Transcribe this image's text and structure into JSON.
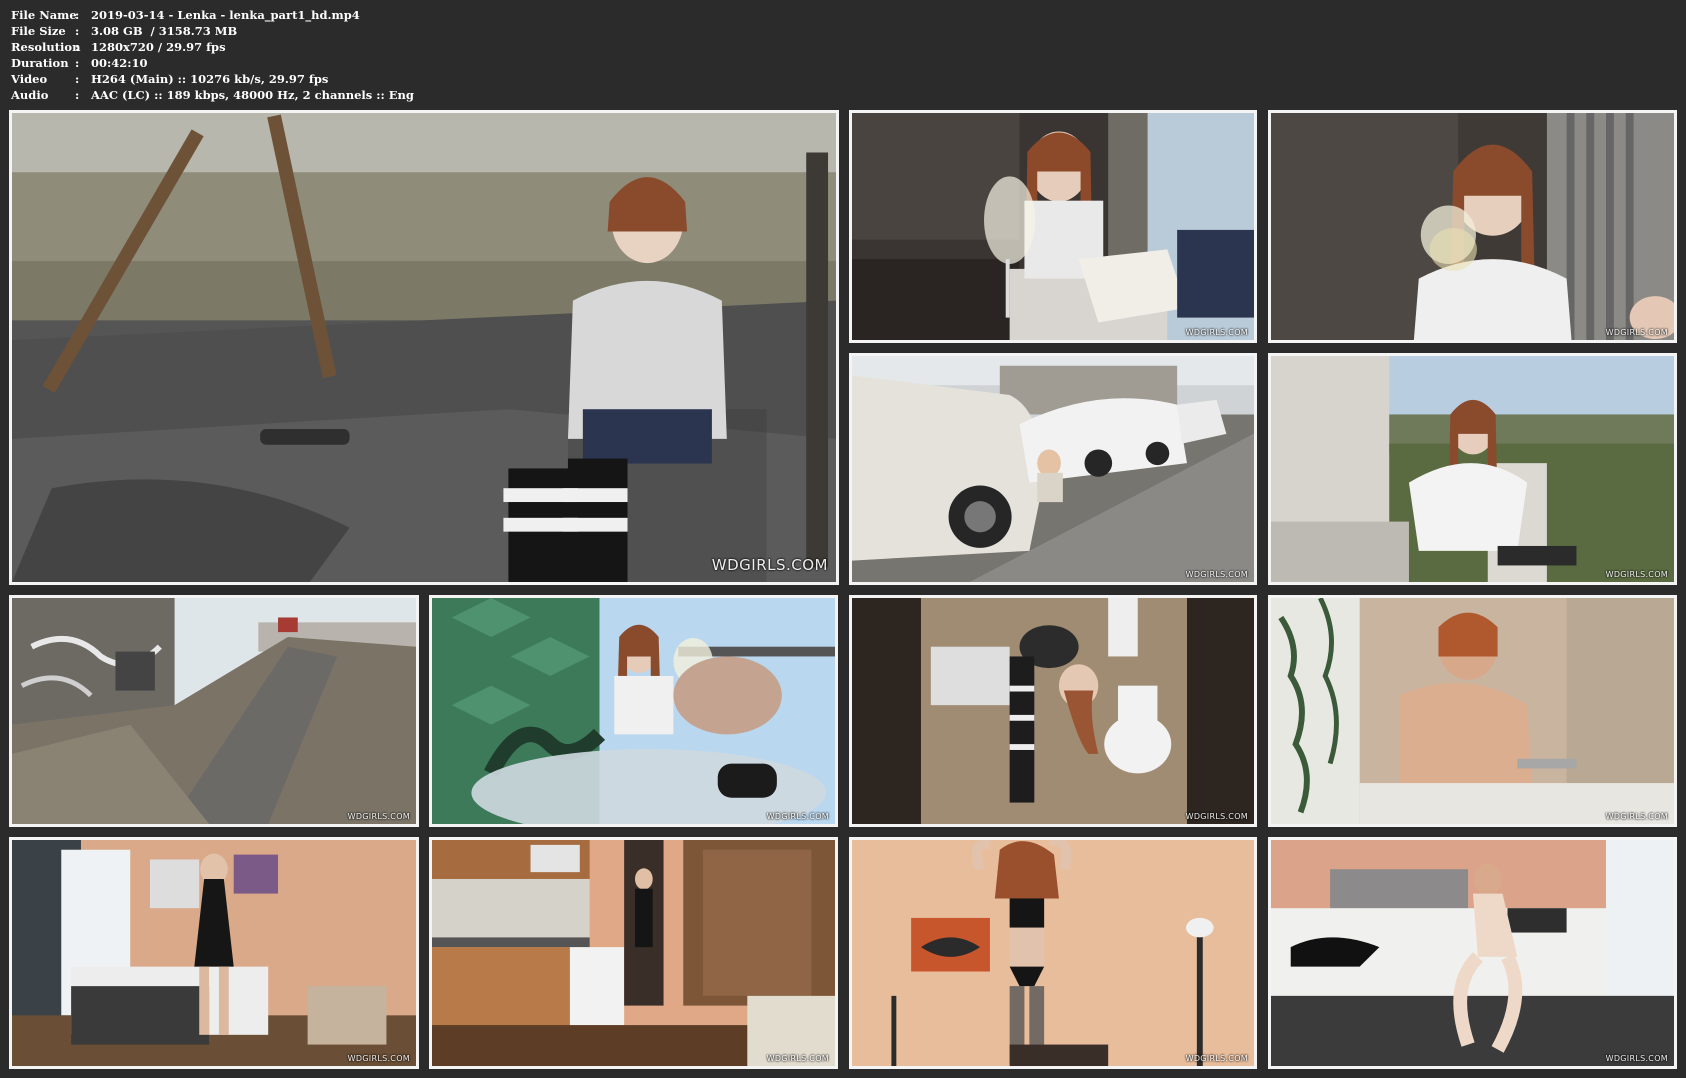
{
  "info": {
    "rows": [
      {
        "label": "File Name",
        "sep": ":",
        "value": "2019-03-14 - Lenka - lenka_part1_hd.mp4"
      },
      {
        "label": "File Size",
        "sep": ":",
        "value": "3.08 GB  / 3158.73 MB"
      },
      {
        "label": "Resolution",
        "sep": ":",
        "value": "1280x720 / 29.97 fps"
      },
      {
        "label": "Duration",
        "sep": ":",
        "value": "00:42:10"
      },
      {
        "label": "Video",
        "sep": ":",
        "value": "H264 (Main) :: 10276 kb/s, 29.97 fps"
      },
      {
        "label": "Audio",
        "sep": ":",
        "value": "AAC (LC) :: 189 kbps, 48000 Hz, 2 channels :: Eng"
      }
    ]
  },
  "thumbnails": [
    {
      "scene": "playground-swing",
      "watermark": "WDGIRLS.COM"
    },
    {
      "scene": "cafe-reading-menu",
      "watermark": "WDGIRLS.COM"
    },
    {
      "scene": "cafe-drinking-wine",
      "watermark": "WDGIRLS.COM"
    },
    {
      "scene": "street-parked-cars",
      "watermark": "WDGIRLS.COM"
    },
    {
      "scene": "park-sitting-wall",
      "watermark": "WDGIRLS.COM"
    },
    {
      "scene": "graffiti-path",
      "watermark": "WDGIRLS.COM"
    },
    {
      "scene": "balcony-wine-toast",
      "watermark": "WDGIRLS.COM"
    },
    {
      "scene": "bathroom-toilet",
      "watermark": "WDGIRLS.COM"
    },
    {
      "scene": "bath-shower",
      "watermark": "WDGIRLS.COM"
    },
    {
      "scene": "bedroom-undressing",
      "watermark": "WDGIRLS.COM"
    },
    {
      "scene": "apartment-kitchen",
      "watermark": "WDGIRLS.COM"
    },
    {
      "scene": "room-dancing",
      "watermark": "WDGIRLS.COM"
    },
    {
      "scene": "bed-lying",
      "watermark": "WDGIRLS.COM"
    }
  ],
  "colors": {
    "background": "#2b2b2b",
    "text": "#ffffff",
    "thumb_border": "#f4f4f4"
  }
}
